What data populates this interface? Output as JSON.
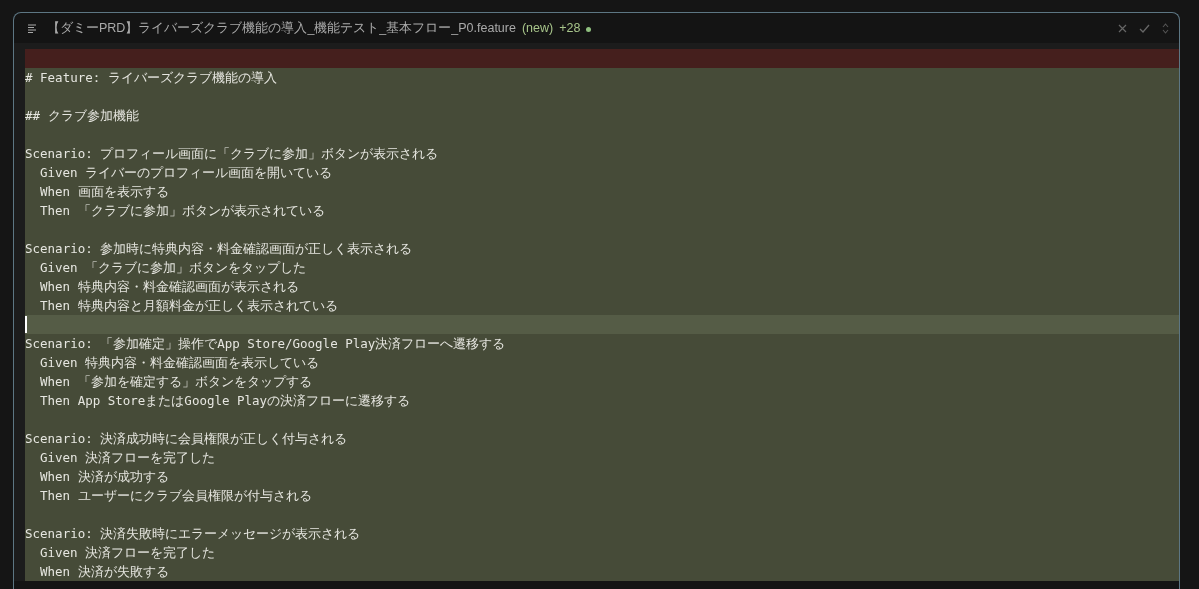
{
  "editor": {
    "title": "【ダミーPRD】ライバーズクラブ機能の導入_機能テスト_基本フロー_P0.feature",
    "status": "(new)",
    "added_count": "+28",
    "modified": true,
    "lines": [
      {
        "kind": "removed",
        "current": false
      },
      {
        "kind": "added",
        "current": false,
        "text": "# Feature: ライバーズクラブ機能の導入"
      },
      {
        "kind": "added",
        "current": false
      },
      {
        "kind": "added",
        "current": false,
        "text": "## クラブ参加機能"
      },
      {
        "kind": "added",
        "current": false
      },
      {
        "kind": "added",
        "current": false,
        "text": "Scenario: プロフィール画面に「クラブに参加」ボタンが表示される",
        "children": [
          {
            "kind": "added",
            "current": false,
            "text": "Given ライバーのプロフィール画面を開いている"
          },
          {
            "kind": "added",
            "current": false,
            "text": "When 画面を表示する"
          },
          {
            "kind": "added",
            "current": false,
            "text": "Then 「クラブに参加」ボタンが表示されている"
          }
        ]
      },
      {
        "kind": "added",
        "current": false
      },
      {
        "kind": "added",
        "current": false,
        "text": "Scenario: 参加時に特典内容・料金確認画面が正しく表示される",
        "children": [
          {
            "kind": "added",
            "current": false,
            "text": "Given 「クラブに参加」ボタンをタップした"
          },
          {
            "kind": "added",
            "current": false,
            "text": "When 特典内容・料金確認画面が表示される"
          },
          {
            "kind": "added",
            "current": false,
            "text": "Then 特典内容と月額料金が正しく表示されている"
          }
        ]
      },
      {
        "kind": "added",
        "current": true
      },
      {
        "kind": "added",
        "current": false,
        "text": "Scenario: 「参加確定」操作でApp Store/Google Play決済フローへ遷移する",
        "children": [
          {
            "kind": "added",
            "current": false,
            "text": "Given 特典内容・料金確認画面を表示している"
          },
          {
            "kind": "added",
            "current": false,
            "text": "When 「参加を確定する」ボタンをタップする"
          },
          {
            "kind": "added",
            "current": false,
            "text": "Then App StoreまたはGoogle Playの決済フローに遷移する"
          }
        ]
      },
      {
        "kind": "added",
        "current": false
      },
      {
        "kind": "added",
        "current": false,
        "text": "Scenario: 決済成功時に会員権限が正しく付与される",
        "children": [
          {
            "kind": "added",
            "current": false,
            "text": "Given 決済フローを完了した"
          },
          {
            "kind": "added",
            "current": false,
            "text": "When 決済が成功する"
          },
          {
            "kind": "added",
            "current": false,
            "text": "Then ユーザーにクラブ会員権限が付与される"
          }
        ]
      },
      {
        "kind": "added",
        "current": false
      },
      {
        "kind": "added",
        "current": false,
        "text": "Scenario: 決済失敗時にエラーメッセージが表示される",
        "children": [
          {
            "kind": "added",
            "current": false,
            "text": "Given 決済フローを完了した"
          },
          {
            "kind": "added",
            "current": false,
            "text": "When 決済が失敗する"
          }
        ]
      }
    ]
  }
}
